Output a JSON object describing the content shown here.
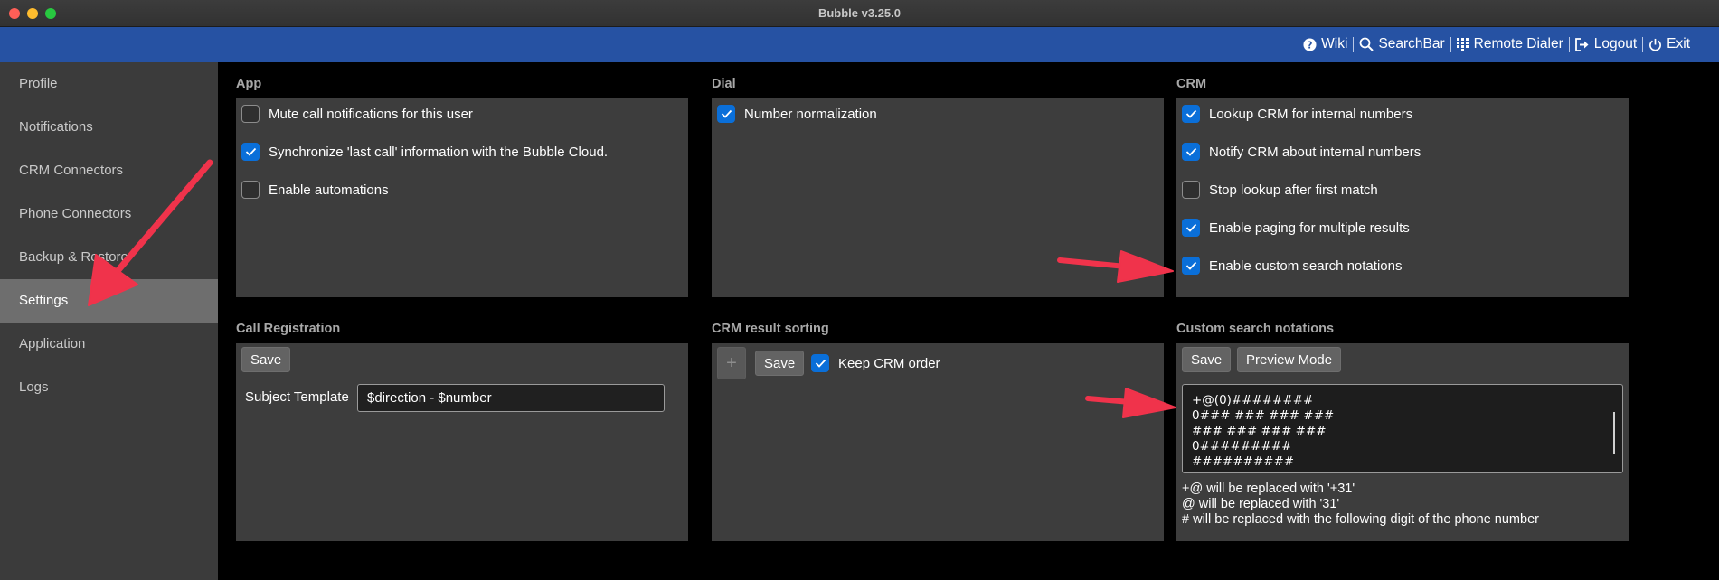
{
  "window": {
    "title": "Bubble v3.25.0"
  },
  "topnav": [
    {
      "label": "Wiki",
      "icon": "help-circle-icon"
    },
    {
      "label": "SearchBar",
      "icon": "search-icon"
    },
    {
      "label": "Remote Dialer",
      "icon": "dialpad-icon"
    },
    {
      "label": "Logout",
      "icon": "logout-icon"
    },
    {
      "label": "Exit",
      "icon": "power-icon"
    }
  ],
  "sidebar": {
    "items": [
      {
        "label": "Profile"
      },
      {
        "label": "Notifications"
      },
      {
        "label": "CRM Connectors"
      },
      {
        "label": "Phone Connectors"
      },
      {
        "label": "Backup & Restore"
      },
      {
        "label": "Settings",
        "active": true
      },
      {
        "label": "Application"
      },
      {
        "label": "Logs"
      }
    ]
  },
  "app": {
    "title": "App",
    "options": [
      {
        "label": "Mute call notifications for this user",
        "checked": false
      },
      {
        "label": "Synchronize 'last call' information with the Bubble Cloud.",
        "checked": true
      },
      {
        "label": "Enable automations",
        "checked": false
      }
    ]
  },
  "dial": {
    "title": "Dial",
    "options": [
      {
        "label": "Number normalization",
        "checked": true
      }
    ]
  },
  "crm": {
    "title": "CRM",
    "options": [
      {
        "label": "Lookup CRM for internal numbers",
        "checked": true
      },
      {
        "label": "Notify CRM about internal numbers",
        "checked": true
      },
      {
        "label": "Stop lookup after first match",
        "checked": false
      },
      {
        "label": "Enable paging for multiple results",
        "checked": true
      },
      {
        "label": "Enable custom search notations",
        "checked": true
      }
    ]
  },
  "call_registration": {
    "title": "Call Registration",
    "save_label": "Save",
    "subject_label": "Subject Template",
    "subject_value": "$direction - $number"
  },
  "crm_sorting": {
    "title": "CRM result sorting",
    "add_label": "+",
    "save_label": "Save",
    "keep_order_label": "Keep CRM order",
    "keep_order_checked": true
  },
  "custom_notations": {
    "title": "Custom search notations",
    "save_label": "Save",
    "preview_label": "Preview Mode",
    "lines": [
      "+@(0)########",
      "0### ### ### ###",
      "### ### ### ###",
      "0#########",
      "##########"
    ],
    "hints": [
      "+@ will be replaced with '+31'",
      "@ will be replaced with '31'",
      "# will be replaced with the following digit of the phone number"
    ]
  },
  "colors": {
    "accent": "#0a6fd9",
    "header": "#2652a3",
    "annotation_arrow": "#f0334b"
  }
}
